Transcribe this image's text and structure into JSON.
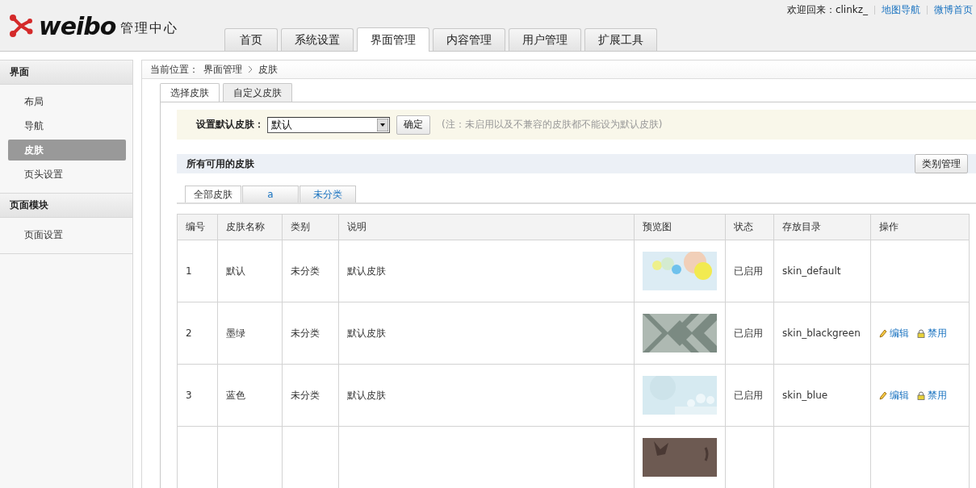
{
  "header": {
    "logo_text": "weibo",
    "subtitle": "管理中心",
    "welcome": "欢迎回来：clinkz_",
    "links": [
      "地图导航",
      "微博首页"
    ]
  },
  "nav_tabs": [
    {
      "label": "首页",
      "selected": false
    },
    {
      "label": "系统设置",
      "selected": false
    },
    {
      "label": "界面管理",
      "selected": true
    },
    {
      "label": "内容管理",
      "selected": false
    },
    {
      "label": "用户管理",
      "selected": false
    },
    {
      "label": "扩展工具",
      "selected": false
    }
  ],
  "sidebar": {
    "groups": [
      {
        "title": "界面",
        "items": [
          {
            "label": "布局",
            "selected": false
          },
          {
            "label": "导航",
            "selected": false
          },
          {
            "label": "皮肤",
            "selected": true
          },
          {
            "label": "页头设置",
            "selected": false
          }
        ]
      },
      {
        "title": "页面模块",
        "items": [
          {
            "label": "页面设置",
            "selected": false
          }
        ]
      }
    ]
  },
  "breadcrumb": {
    "prefix": "当前位置：",
    "items": [
      "界面管理",
      "皮肤"
    ]
  },
  "sub_tabs": [
    {
      "label": "选择皮肤",
      "selected": true
    },
    {
      "label": "自定义皮肤",
      "selected": false
    }
  ],
  "default_skin": {
    "label": "设置默认皮肤：",
    "value": "默认",
    "button": "确定",
    "note": "(注：未启用以及不兼容的皮肤都不能设为默认皮肤)"
  },
  "skins_section": {
    "title": "所有可用的皮肤",
    "button": "类别管理"
  },
  "category_tabs": [
    {
      "label": "全部皮肤",
      "selected": true
    },
    {
      "label": "a",
      "selected": false
    },
    {
      "label": "未分类",
      "selected": false
    }
  ],
  "table": {
    "columns": [
      "编号",
      "皮肤名称",
      "类别",
      "说明",
      "预览图",
      "状态",
      "存放目录",
      "操作"
    ],
    "rows": [
      {
        "id": "1",
        "name": "默认",
        "category": "未分类",
        "description": "默认皮肤",
        "preview": {
          "kind": "bubbles"
        },
        "status": "已启用",
        "directory": "skin_default",
        "actions": []
      },
      {
        "id": "2",
        "name": "墨绿",
        "category": "未分类",
        "description": "默认皮肤",
        "preview": {
          "kind": "diamonds"
        },
        "status": "已启用",
        "directory": "skin_blackgreen",
        "actions": [
          {
            "kind": "edit",
            "label": "编辑"
          },
          {
            "kind": "disable",
            "label": "禁用"
          }
        ]
      },
      {
        "id": "3",
        "name": "蓝色",
        "category": "未分类",
        "description": "默认皮肤",
        "preview": {
          "kind": "pale"
        },
        "status": "已启用",
        "directory": "skin_blue",
        "actions": [
          {
            "kind": "edit",
            "label": "编辑"
          },
          {
            "kind": "disable",
            "label": "禁用"
          }
        ]
      },
      {
        "preview": {
          "kind": "birds"
        }
      }
    ]
  }
}
